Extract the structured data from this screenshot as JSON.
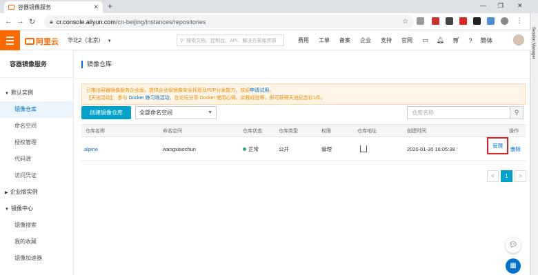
{
  "browser": {
    "tab_title": "容器镜像服务",
    "url_host": "cr.console.aliyun.com",
    "url_path": "/cn-beijing/instances/repositories",
    "side_panel": "Session Manager"
  },
  "topbar": {
    "logo_text": "阿里云",
    "region": "华北2（北京）",
    "search_placeholder": "搜索文档、控制台、API、解决方案和资源",
    "links": [
      "费用",
      "工单",
      "备案",
      "企业",
      "支持",
      "官网"
    ],
    "lang": "简体"
  },
  "sidebar": {
    "title": "容器镜像服务",
    "groups": [
      {
        "label": "默认实例",
        "items": [
          "镜像仓库",
          "命名空间",
          "授权管理",
          "代码源",
          "访问凭证"
        ]
      },
      {
        "label": "企业版实例",
        "items": []
      },
      {
        "label": "镜像中心",
        "items": [
          "镜像搜索",
          "我的收藏",
          "镜像加速器"
        ]
      }
    ],
    "active_item": "镜像仓库"
  },
  "main": {
    "breadcrumb": "镜像仓库",
    "notice_line1_prefix": "已推出容器镜像服务企业版，提供企业级镜像安全托管及P2P分发能力，欢迎",
    "notice_line1_link": "申请试用",
    "notice_line1_suffix": "。",
    "notice_line2_prefix": "【天池活动】：参与",
    "notice_line2_link": "Docker 练习场活动",
    "notice_line2_suffix": "，在论坛分享 Docker 使用心得、实践经验等，即可获得天池纪念衫1件。",
    "create_button": "创建镜像仓库",
    "namespace_select": "全部命名空间",
    "search_placeholder": "仓库名称",
    "columns": [
      "仓库名称",
      "命名空间",
      "仓库状态",
      "仓库类型",
      "权限",
      "仓库地址",
      "创建时间",
      "操作"
    ],
    "rows": [
      {
        "name": "alpine",
        "namespace": "wangxiaochun",
        "status": "正常",
        "type": "公开",
        "permission": "管理",
        "created": "2020-01-30 16:05:38",
        "action_manage": "管理",
        "action_delete": "删除"
      }
    ],
    "pager": {
      "prev": "<",
      "current": "1",
      "next": ">"
    }
  },
  "colors": {
    "accent": "#ff6a00",
    "primary": "#00a2ca",
    "link": "#0070cc",
    "highlight": "#e02020"
  }
}
